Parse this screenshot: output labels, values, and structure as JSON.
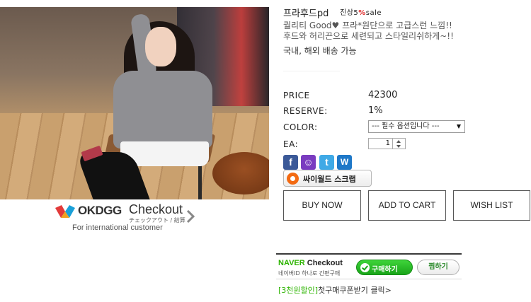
{
  "product": {
    "name": "프라후드pd",
    "sale_prefix": "진상5",
    "sale_pct": "%",
    "sale_suffix": "sale",
    "desc_line1": "퀄리티 Good♥ 프라*원단으로 고급스런 느낌!!",
    "desc_line2": "후드와 허리끈으로 세련되고 스타일리쉬하게~!!",
    "shipping": "국내, 해외 배송 가능"
  },
  "fields": {
    "price_label": "PRICE",
    "price_value": "42300",
    "reserve_label": "RESERVE:",
    "reserve_value": "1%",
    "color_label": "COLOR:",
    "color_selected": "--- 필수 옵션입니다 ---",
    "ea_label": "EA:",
    "ea_value": "1"
  },
  "share": {
    "facebook_glyph": "f",
    "me2day_glyph": "☺",
    "twitter_glyph": "t",
    "w_glyph": "W",
    "cyworld_label": "싸이월드 스크랩"
  },
  "buttons": {
    "buy_now": "BUY NOW",
    "add_to_cart": "ADD TO CART",
    "wish_list": "WISH LIST"
  },
  "okdgg": {
    "logo_text": "OKDGG",
    "checkout": "Checkout",
    "sub": "チェックアウト / 結算",
    "intl": "For international customer"
  },
  "naver": {
    "brand": "NAVER",
    "checkout": "Checkout",
    "sub": "네이버ID 하나로 간편구매",
    "buy_label": "구매하기",
    "wish_label": "찜하기",
    "coupon_bracket": "[3천원할인]",
    "coupon_text": "첫구매쿠폰받기 클릭>"
  },
  "colors": {
    "naver_green": "#2db400",
    "sale_red": "#dd2222",
    "facebook": "#3b5998",
    "twitter": "#3fa9e6"
  }
}
